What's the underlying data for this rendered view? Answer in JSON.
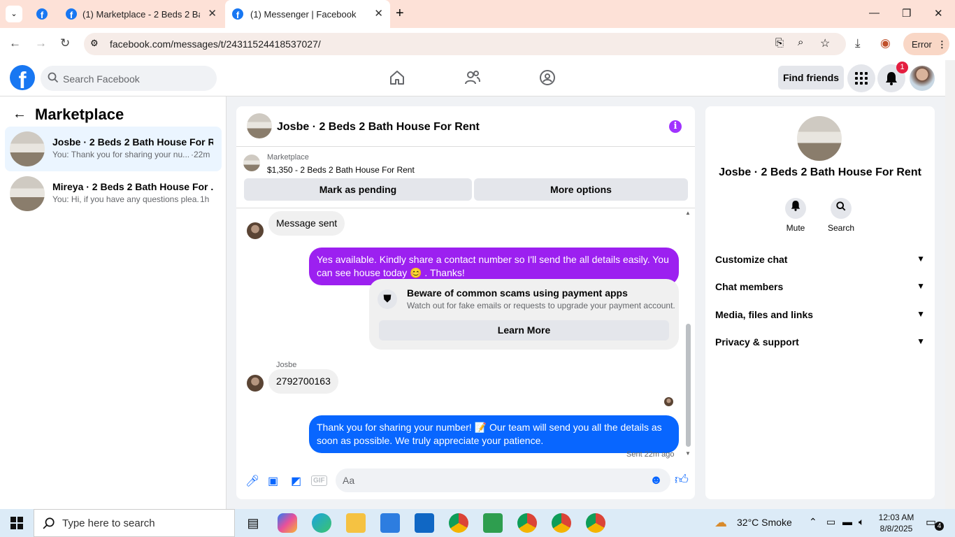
{
  "browser": {
    "tabs": [
      {
        "title": "(1) Marketplace - 2 Beds 2 Bath"
      },
      {
        "title": "(1) Messenger | Facebook"
      }
    ],
    "url": "facebook.com/messages/t/24311524418537027/",
    "error_label": "Error"
  },
  "fb_header": {
    "search_placeholder": "Search Facebook",
    "find_friends_label": "Find friends",
    "notification_count": "1"
  },
  "sidebar": {
    "title": "Marketplace",
    "conversations": [
      {
        "name": "Josbe · 2 Beds 2 Bath House For R...",
        "preview": "You: Thank you for sharing your nu...",
        "time": "·22m"
      },
      {
        "name": "Mireya · 2 Beds 2 Bath House For ...",
        "preview": "You: Hi, if you have any questions plea...",
        "time": "1h"
      }
    ]
  },
  "chat": {
    "title": "Josbe · 2 Beds 2 Bath House For Rent",
    "listing_label": "Marketplace",
    "listing_price": "$1,350 - 2 Beds 2 Bath House For Rent",
    "mark_pending_label": "Mark as pending",
    "more_options_label": "More options",
    "messages": {
      "m1": "Message sent",
      "m2": "Yes available. Kindly share a contact number so I'll send the all details easily. You can see house today 😊 . Thanks!",
      "sender_name": "Josbe",
      "m3": "2792700163",
      "m4": "Thank you for sharing your number! 📝 Our team will send you all the details as soon as possible. We truly appreciate your patience.",
      "sent_status": "Sent 22m ago"
    },
    "scam_card": {
      "title": "Beware of common scams using payment apps",
      "desc": "Watch out for fake emails or requests to upgrade your payment account.",
      "button": "Learn More"
    },
    "composer_placeholder": "Aa"
  },
  "info_panel": {
    "title": "Josbe · 2 Beds 2 Bath House For Rent",
    "actions": [
      "Mute",
      "Search"
    ],
    "sections": [
      "Customize chat",
      "Chat members",
      "Media, files and links",
      "Privacy & support"
    ]
  },
  "taskbar": {
    "search_placeholder": "Type here to search",
    "weather": "32°C  Smoke",
    "time": "12:03 AM",
    "date": "8/8/2025",
    "notif_count": "4"
  },
  "colors": {
    "facebook_blue": "#1877f2",
    "purple_bubble": "#9c20f0",
    "blue_bubble": "#0866ff"
  }
}
